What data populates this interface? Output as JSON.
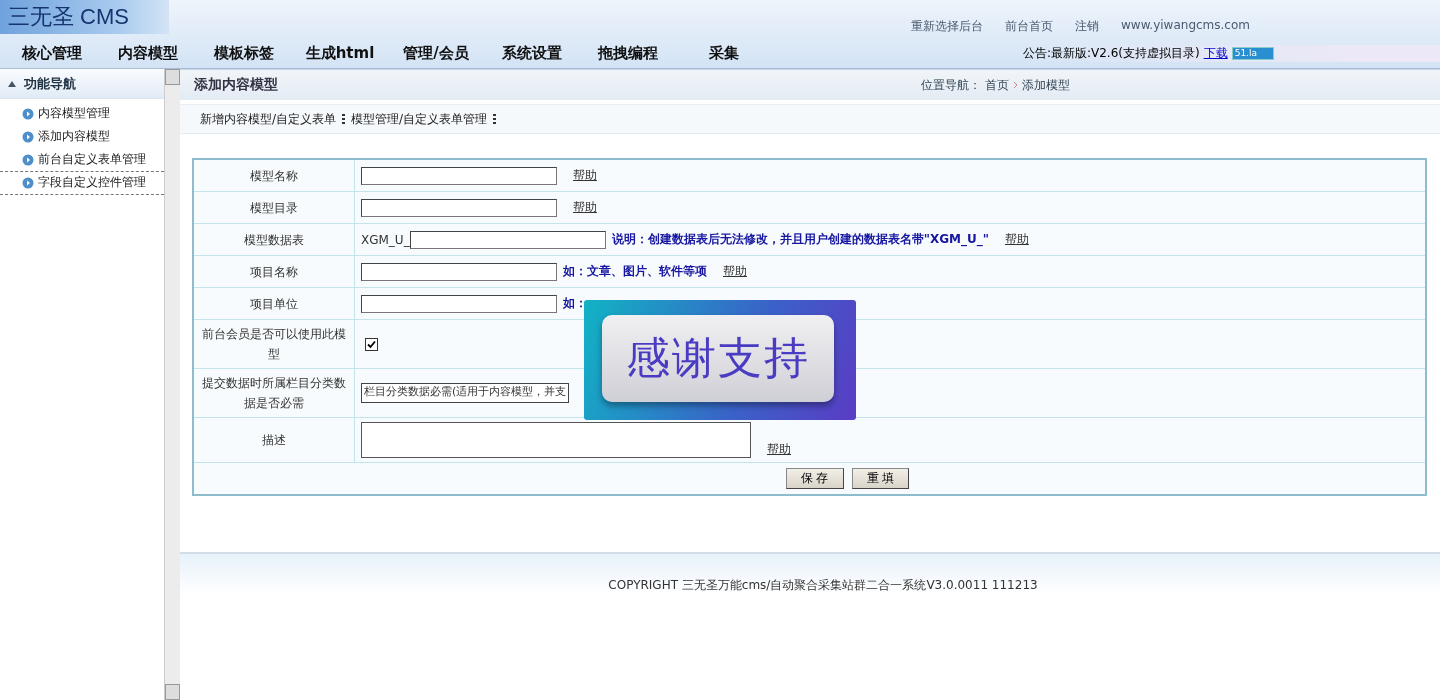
{
  "logo": "三无圣 CMS",
  "top_links": [
    "重新选择后台",
    "前台首页",
    "注销",
    "www.yiwangcms.com"
  ],
  "menu": [
    "核心管理",
    "内容模型",
    "模板标签",
    "生成html",
    "管理/会员",
    "系统设置",
    "拖拽编程",
    "采集"
  ],
  "notice": {
    "text": "公告:最新版:V2.6(支持虚拟目录)",
    "link": "下载",
    "badge": "51.la"
  },
  "sidebar": {
    "title": "功能导航",
    "items": [
      {
        "label": "内容模型管理",
        "dashed": false
      },
      {
        "label": "添加内容模型",
        "dashed": false
      },
      {
        "label": "前台自定义表单管理",
        "dashed": true
      },
      {
        "label": "字段自定义控件管理",
        "dashed": true
      }
    ]
  },
  "page": {
    "title": "添加内容模型",
    "breadcrumb_label": "位置导航：",
    "breadcrumb": [
      "首页",
      "添加模型"
    ]
  },
  "tabs": [
    "新增内容模型/自定义表单",
    "模型管理/自定义表单管理"
  ],
  "form": {
    "rows": [
      {
        "kind": "text",
        "label": "模型名称",
        "help": "帮助"
      },
      {
        "kind": "text",
        "label": "模型目录",
        "help": "帮助"
      },
      {
        "kind": "prefixed",
        "label": "模型数据表",
        "prefix": "XGM_U_",
        "note": "说明：创建数据表后无法修改，并且用户创建的数据表名带\"XGM_U_\"",
        "help": "帮助"
      },
      {
        "kind": "text",
        "label": "项目名称",
        "note": "如：文章、图片、软件等项",
        "help": "帮助"
      },
      {
        "kind": "text",
        "label": "项目单位",
        "note": "如："
      },
      {
        "kind": "checkbox",
        "label": "前台会员是否可以使用此模型",
        "checked": true
      },
      {
        "kind": "select",
        "label": "提交数据时所属栏目分类数据是否必需",
        "value": "栏目分类数据必需(适用于内容模型，并支"
      },
      {
        "kind": "textarea",
        "label": "描述",
        "help": "帮助"
      }
    ],
    "buttons": [
      "保 存",
      "重 填"
    ]
  },
  "overlay": {
    "text": "感谢支持"
  },
  "footer": "COPYRIGHT 三无圣万能cms/自动聚合采集站群二合一系统V3.0.0011 111213"
}
